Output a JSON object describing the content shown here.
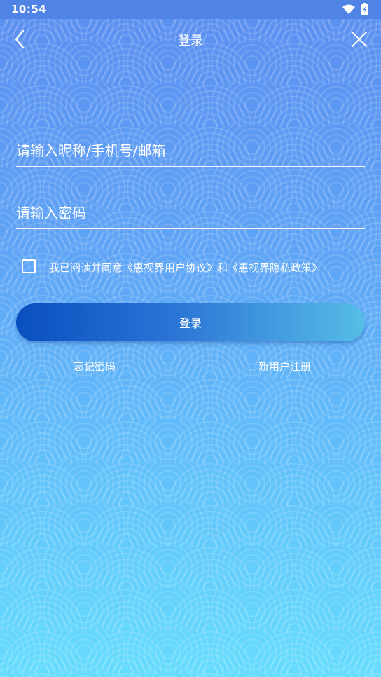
{
  "status_bar": {
    "time": "10:54",
    "icons": [
      "wifi-icon",
      "battery-charging-icon"
    ]
  },
  "nav": {
    "title": "登录",
    "back_icon": "chevron-left-icon",
    "close_icon": "close-icon"
  },
  "form": {
    "account": {
      "value": "",
      "placeholder": "请输入昵称/手机号/邮箱"
    },
    "password": {
      "value": "",
      "placeholder": "请输入密码"
    }
  },
  "agreement": {
    "checked": false,
    "prefix": "我已阅读并同意",
    "user_agreement": "《惠视界用户协议》",
    "conjunction": "和",
    "privacy_policy": "《惠视界隐私政策》"
  },
  "login_button": {
    "label": "登录"
  },
  "links": {
    "forgot_password": "忘记密码",
    "register": "新用户注册"
  },
  "colors": {
    "background_top": "#5b8ef0",
    "background_bottom": "#66dcfd",
    "button_start": "#0a4fbf",
    "button_end": "#57bde6",
    "text": "#ffffff"
  }
}
